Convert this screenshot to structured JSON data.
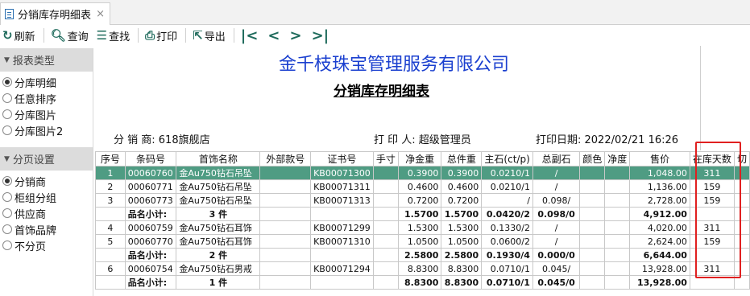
{
  "tab": {
    "label": "分销库存明细表",
    "close": "×"
  },
  "toolbar": {
    "refresh": "刷新",
    "query": "查询",
    "find": "查找",
    "print": "打印",
    "export": "导出"
  },
  "sidebar": {
    "report_type": {
      "title": "报表类型",
      "items": [
        "分库明细",
        "任意排序",
        "分库图片",
        "分库图片2"
      ],
      "selected": 0
    },
    "paging": {
      "title": "分页设置",
      "items": [
        "分销商",
        "柜组分组",
        "供应商",
        "首饰品牌",
        "不分页"
      ],
      "selected": 0
    }
  },
  "report": {
    "company": "金千枝珠宝管理服务有限公司",
    "title": "分销库存明细表",
    "distributor": "分 销 商: 618旗舰店",
    "printer": "打 印 人: 超级管理员",
    "print_date": "打印日期: 2022/02/21 16:26"
  },
  "table": {
    "headers": [
      "序号",
      "条码号",
      "首饰名称",
      "外部款号",
      "证书号",
      "手寸",
      "净金重",
      "总件重",
      "主石(ct/p)",
      "总副石",
      "颜色",
      "净度",
      "售价",
      "在库天数",
      "切"
    ],
    "rows": [
      {
        "type": "item",
        "selected": true,
        "cells": [
          "1",
          "00060760",
          "金Au750钻石吊坠",
          "",
          "KB00071300",
          "",
          "0.3900",
          "0.3900",
          "0.0210/1",
          "/",
          "",
          "",
          "1,048.00",
          "311",
          ""
        ]
      },
      {
        "type": "item",
        "cells": [
          "2",
          "00060771",
          "金Au750钻石吊坠",
          "",
          "KB00071311",
          "",
          "0.4600",
          "0.4600",
          "0.0210/1",
          "/",
          "",
          "",
          "1,136.00",
          "159",
          ""
        ]
      },
      {
        "type": "item",
        "cells": [
          "3",
          "00060773",
          "金Au750钻石吊坠",
          "",
          "KB00071313",
          "",
          "0.7200",
          "0.7200",
          "/",
          "0.098/",
          "",
          "",
          "2,728.00",
          "159",
          ""
        ]
      },
      {
        "type": "subtotal",
        "cells": [
          "",
          "品名小计:",
          "3 件",
          "",
          "",
          "",
          "1.5700",
          "1.5700",
          "0.0420/2",
          "0.098/0",
          "",
          "",
          "4,912.00",
          "",
          ""
        ]
      },
      {
        "type": "item",
        "cells": [
          "4",
          "00060759",
          "金Au750钻石耳饰",
          "",
          "KB00071299",
          "",
          "1.5300",
          "1.5300",
          "0.1330/2",
          "/",
          "",
          "",
          "4,020.00",
          "311",
          ""
        ]
      },
      {
        "type": "item",
        "cells": [
          "5",
          "00060770",
          "金Au750钻石耳饰",
          "",
          "KB00071310",
          "",
          "1.0500",
          "1.0500",
          "0.0600/2",
          "/",
          "",
          "",
          "2,624.00",
          "159",
          ""
        ]
      },
      {
        "type": "subtotal",
        "cells": [
          "",
          "品名小计:",
          "2 件",
          "",
          "",
          "",
          "2.5800",
          "2.5800",
          "0.1930/4",
          "0.000/0",
          "",
          "",
          "6,644.00",
          "",
          ""
        ]
      },
      {
        "type": "item",
        "cells": [
          "6",
          "00060754",
          "金Au750钻石男戒",
          "",
          "KB00071294",
          "",
          "8.8300",
          "8.8300",
          "0.0710/1",
          "0.045/",
          "",
          "",
          "13,928.00",
          "311",
          ""
        ]
      },
      {
        "type": "subtotal",
        "cells": [
          "",
          "品名小计:",
          "1 件",
          "",
          "",
          "",
          "8.8300",
          "8.8300",
          "0.0710/1",
          "0.045/0",
          "",
          "",
          "13,928.00",
          "",
          ""
        ]
      }
    ]
  },
  "colors": {
    "accent": "#1f6b5c",
    "selected_row": "#4f9c83",
    "company_title": "#1a3fcf",
    "highlight_box": "#e02020"
  }
}
